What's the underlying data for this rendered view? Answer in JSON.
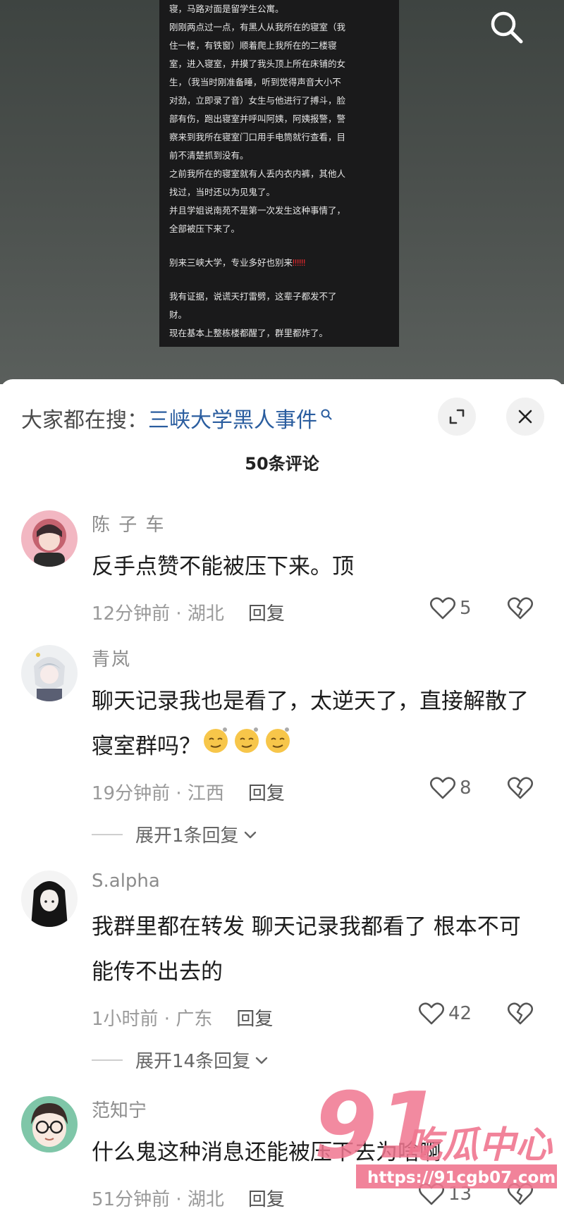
{
  "background_note": {
    "lines": [
      "寝，马路对面是留学生公寓。",
      "刚刚两点过一点，有黑人从我所在的寝室（我",
      "住一楼，有铁窗）顺着爬上我所在的二楼寝",
      "室，进入寝室，并摸了我头顶上所在床铺的女",
      "生，（我当时刚准备睡，听到觉得声音大小不",
      "对劲，立即录了音）女生与他进行了搏斗，脸",
      "部有伤，跑出寝室并呼叫阿姨，阿姨报警，警",
      "察来到我所在寝室门口用手电筒就行查看，目",
      "前不清楚抓到没有。",
      "之前我所在的寝室就有人丢内衣内裤，其他人",
      "找过，当时还以为见鬼了。",
      "并且学姐说南苑不是第一次发生这种事情了，",
      "全部被压下来了。"
    ],
    "warning_text": "别来三峡大学，专业多好也别来",
    "warning_marks": "‼‼‼",
    "closing_lines": [
      "我有证据，说谎天打雷劈，这辈子都发不了",
      "财。",
      "现在基本上整栋楼都醒了，群里都炸了。"
    ]
  },
  "header": {
    "search_prefix": "大家都在搜：",
    "search_term": "三峡大学黑人事件"
  },
  "comment_count": "50条评论",
  "comments": [
    {
      "name": "陈 子 车",
      "text": "反手点赞不能被压下来。顶",
      "time_location": "12分钟前 · 湖北",
      "reply_label": "回复",
      "likes": "5"
    },
    {
      "name": "青岚",
      "text": "聊天记录我也是看了，太逆天了，直接解散了寝室群吗？",
      "time_location": "19分钟前 · 江西",
      "reply_label": "回复",
      "likes": "8",
      "expand_label": "展开1条回复"
    },
    {
      "name": "S.alpha",
      "text": "我群里都在转发 聊天记录我都看了 根本不可能传不出去的",
      "time_location": "1小时前 · 广东",
      "reply_label": "回复",
      "likes": "42",
      "expand_label": "展开14条回复"
    },
    {
      "name": "范知宁",
      "text": "什么鬼这种消息还能被压下去为啥啊",
      "time_location": "51分钟前 · 湖北",
      "reply_label": "回复",
      "likes": "13"
    }
  ],
  "watermark": {
    "number": "91",
    "brand": "吃瓜中心",
    "url": "https://91cgb07.com"
  },
  "colors": {
    "search_link": "#2a5d9f",
    "watermark_pink": "#f0768f",
    "warning_red": "#e0262b"
  }
}
